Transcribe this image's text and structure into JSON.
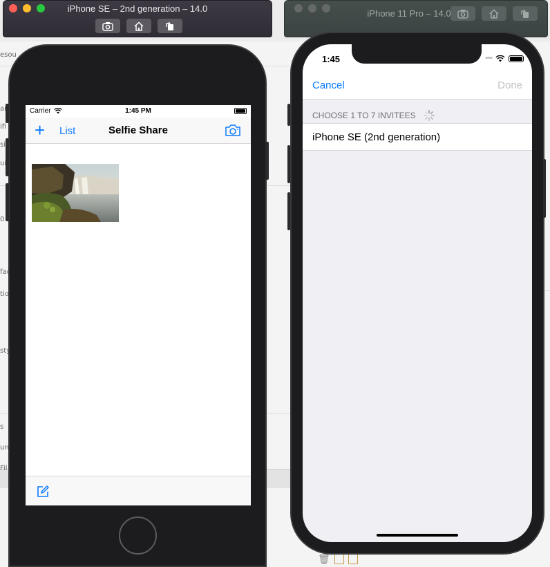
{
  "windows": {
    "se": {
      "title": "iPhone SE – 2nd generation – 14.0",
      "toolbar_icons": [
        "screenshot-icon",
        "home-icon",
        "rotate-icon"
      ]
    },
    "pro": {
      "title": "iPhone 11 Pro – 14.0",
      "toolbar_icons": [
        "screenshot-icon",
        "home-icon",
        "rotate-icon"
      ]
    }
  },
  "background_fragments": [
    "esou",
    "an",
    "ifi",
    "sio",
    "ui",
    "0",
    "fac",
    "tio",
    "styl",
    "s",
    "urc",
    "Fil"
  ],
  "se_app": {
    "status": {
      "carrier": "Carrier",
      "time": "1:45 PM"
    },
    "nav": {
      "add_icon": "plus-icon",
      "list_label": "List",
      "title": "Selfie Share",
      "camera_icon": "camera-icon"
    },
    "photos": [
      {
        "description": "waterfall-thumbnail"
      }
    ],
    "toolbar": {
      "compose_icon": "compose-icon"
    }
  },
  "pro_app": {
    "status": {
      "time": "1:45"
    },
    "nav": {
      "cancel_label": "Cancel",
      "done_label": "Done"
    },
    "section_header": "CHOOSE 1 TO 7 INVITEES",
    "invitees": [
      "iPhone SE (2nd generation)"
    ]
  },
  "colors": {
    "accent": "#0a7aff",
    "disabled": "#c2c2c6",
    "device_body": "#1c1c1e"
  }
}
